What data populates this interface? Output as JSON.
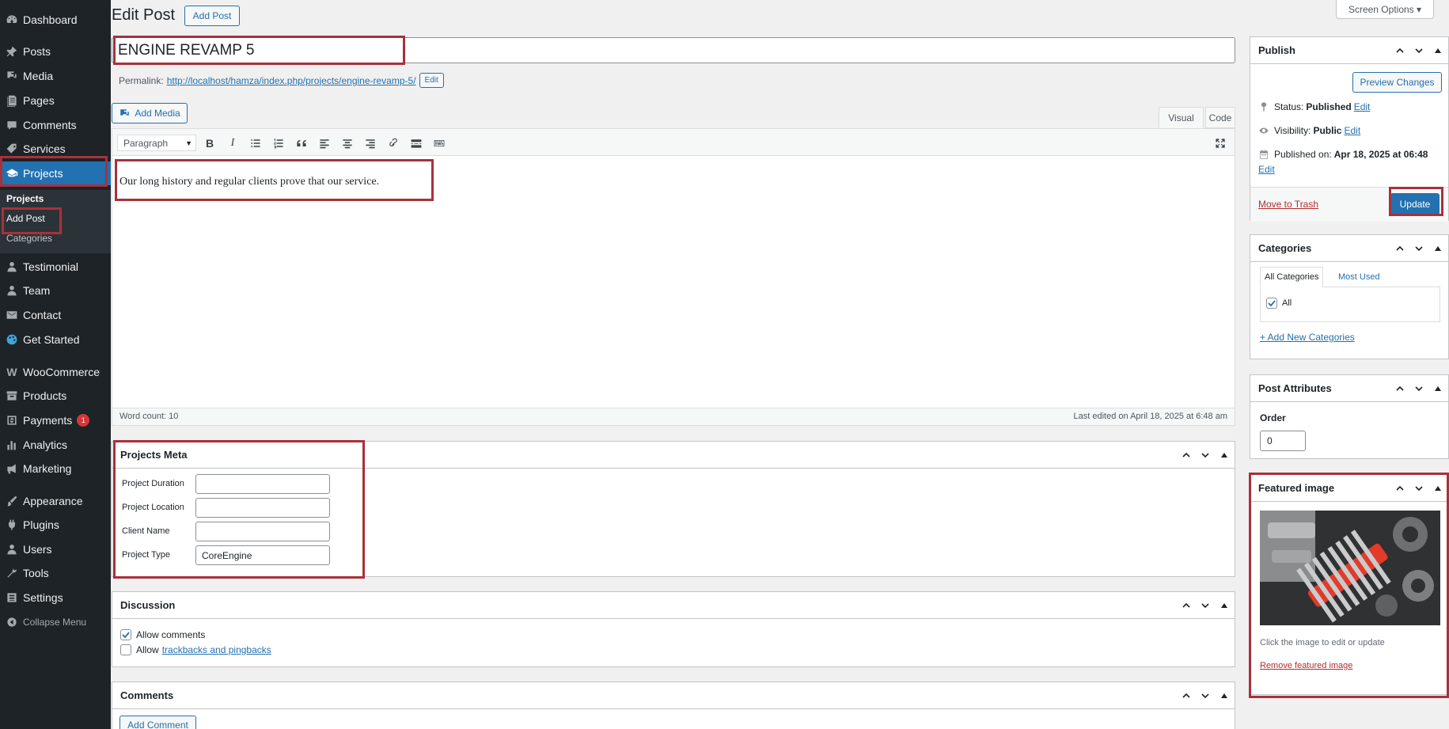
{
  "sidebar": {
    "items": [
      {
        "label": "Dashboard",
        "icon": "dashboard-icon"
      },
      {
        "label": "Posts",
        "icon": "pin-icon"
      },
      {
        "label": "Media",
        "icon": "media-icon"
      },
      {
        "label": "Pages",
        "icon": "pages-icon"
      },
      {
        "label": "Comments",
        "icon": "comment-icon"
      },
      {
        "label": "Services",
        "icon": "tag-icon"
      },
      {
        "label": "Projects",
        "icon": "graduation-cap-icon"
      },
      {
        "label": "Testimonial",
        "icon": "person-icon"
      },
      {
        "label": "Team",
        "icon": "person-icon"
      },
      {
        "label": "Contact",
        "icon": "mail-icon"
      },
      {
        "label": "Get Started",
        "icon": "palette-icon"
      },
      {
        "label": "WooCommerce",
        "icon": "woo-icon"
      },
      {
        "label": "Products",
        "icon": "archive-icon"
      },
      {
        "label": "Payments",
        "icon": "payment-icon",
        "badge": "1"
      },
      {
        "label": "Analytics",
        "icon": "chart-bar-icon"
      },
      {
        "label": "Marketing",
        "icon": "megaphone-icon"
      },
      {
        "label": "Appearance",
        "icon": "brush-icon"
      },
      {
        "label": "Plugins",
        "icon": "plugin-icon"
      },
      {
        "label": "Users",
        "icon": "users-icon"
      },
      {
        "label": "Tools",
        "icon": "wrench-icon"
      },
      {
        "label": "Settings",
        "icon": "settings-icon"
      }
    ],
    "submenu": {
      "head": "Projects",
      "add_post": "Add Post",
      "categories": "Categories"
    },
    "collapse_label": "Collapse Menu"
  },
  "header": {
    "title": "Edit Post",
    "add_post_button": "Add Post",
    "screen_options": "Screen Options ▾"
  },
  "post": {
    "title": "ENGINE REVAMP 5",
    "permalink_label": "Permalink:",
    "permalink_url": "http://localhost/hamza/index.php/projects/engine-revamp-5/",
    "permalink_edit": "Edit"
  },
  "editor": {
    "add_media": "Add Media",
    "tab_visual": "Visual",
    "tab_code": "Code",
    "format_select": "Paragraph",
    "content": "Our long history and regular clients prove that our service.",
    "word_count": "Word count: 10",
    "last_edited": "Last edited on April 18, 2025 at 6:48 am"
  },
  "projects_meta": {
    "title": "Projects Meta",
    "fields": [
      {
        "label": "Project Duration",
        "value": ""
      },
      {
        "label": "Project Location",
        "value": ""
      },
      {
        "label": "Client Name",
        "value": ""
      },
      {
        "label": "Project Type",
        "value": "CoreEngine"
      }
    ]
  },
  "discussion": {
    "title": "Discussion",
    "allow_comments": "Allow comments",
    "allow_prefix": "Allow",
    "trackbacks_link": "trackbacks and pingbacks"
  },
  "comments": {
    "title": "Comments",
    "add_comment": "Add Comment"
  },
  "publish": {
    "title": "Publish",
    "preview_changes": "Preview Changes",
    "status_label": "Status:",
    "status_value": "Published",
    "visibility_label": "Visibility:",
    "visibility_value": "Public",
    "published_label": "Published on:",
    "published_value": "Apr 18, 2025 at 06:48",
    "edit": "Edit",
    "move_to_trash": "Move to Trash",
    "update": "Update"
  },
  "categories": {
    "title": "Categories",
    "tab_all": "All Categories",
    "tab_most_used": "Most Used",
    "items": [
      {
        "label": "All",
        "checked": true
      }
    ],
    "add_new": "+ Add New Categories"
  },
  "post_attributes": {
    "title": "Post Attributes",
    "order_label": "Order",
    "order_value": "0"
  },
  "featured_image": {
    "title": "Featured image",
    "hint": "Click the image to edit or update",
    "remove": "Remove featured image"
  },
  "colors": {
    "sidebar_bg": "#1d2327",
    "accent": "#2271b1",
    "highlight_border": "#a8313a",
    "danger": "#b32d2e"
  }
}
